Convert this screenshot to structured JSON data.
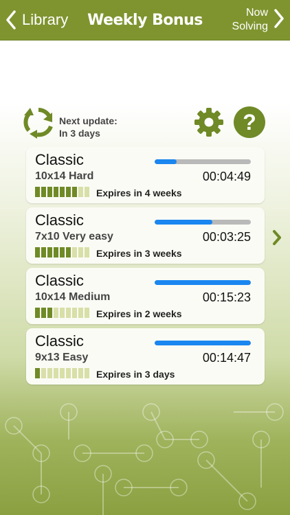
{
  "nav": {
    "back_label": "Library",
    "title": "Weekly Bonus",
    "forward_label_line1": "Now",
    "forward_label_line2": "Solving"
  },
  "info": {
    "update_line1": "Next update:",
    "update_line2": "In 3 days"
  },
  "colors": {
    "accent": "#7f942f",
    "progress": "#1a86f0",
    "segment_on": "#6f8a26",
    "segment_off": "#d8dfa8"
  },
  "icons": [
    "chevron-left-icon",
    "chevron-right-icon",
    "refresh-icon",
    "gear-icon",
    "question-icon"
  ],
  "puzzles": [
    {
      "name": "Classic",
      "size": "10x14 Hard",
      "time": "00:04:49",
      "progress": 0.23,
      "segments_filled": 7,
      "segments_total": 9,
      "expires": "Expires in 4 weeks"
    },
    {
      "name": "Classic",
      "size": "7x10 Very easy",
      "time": "00:03:25",
      "progress": 0.6,
      "segments_filled": 6,
      "segments_total": 9,
      "expires": "Expires in 3 weeks"
    },
    {
      "name": "Classic",
      "size": "10x14 Medium",
      "time": "00:15:23",
      "progress": 1.0,
      "segments_filled": 3,
      "segments_total": 9,
      "expires": "Expires in 2 weeks"
    },
    {
      "name": "Classic",
      "size": "9x13 Easy",
      "time": "00:14:47",
      "progress": 1.0,
      "segments_filled": 1,
      "segments_total": 9,
      "expires": "Expires in 3 days"
    }
  ]
}
